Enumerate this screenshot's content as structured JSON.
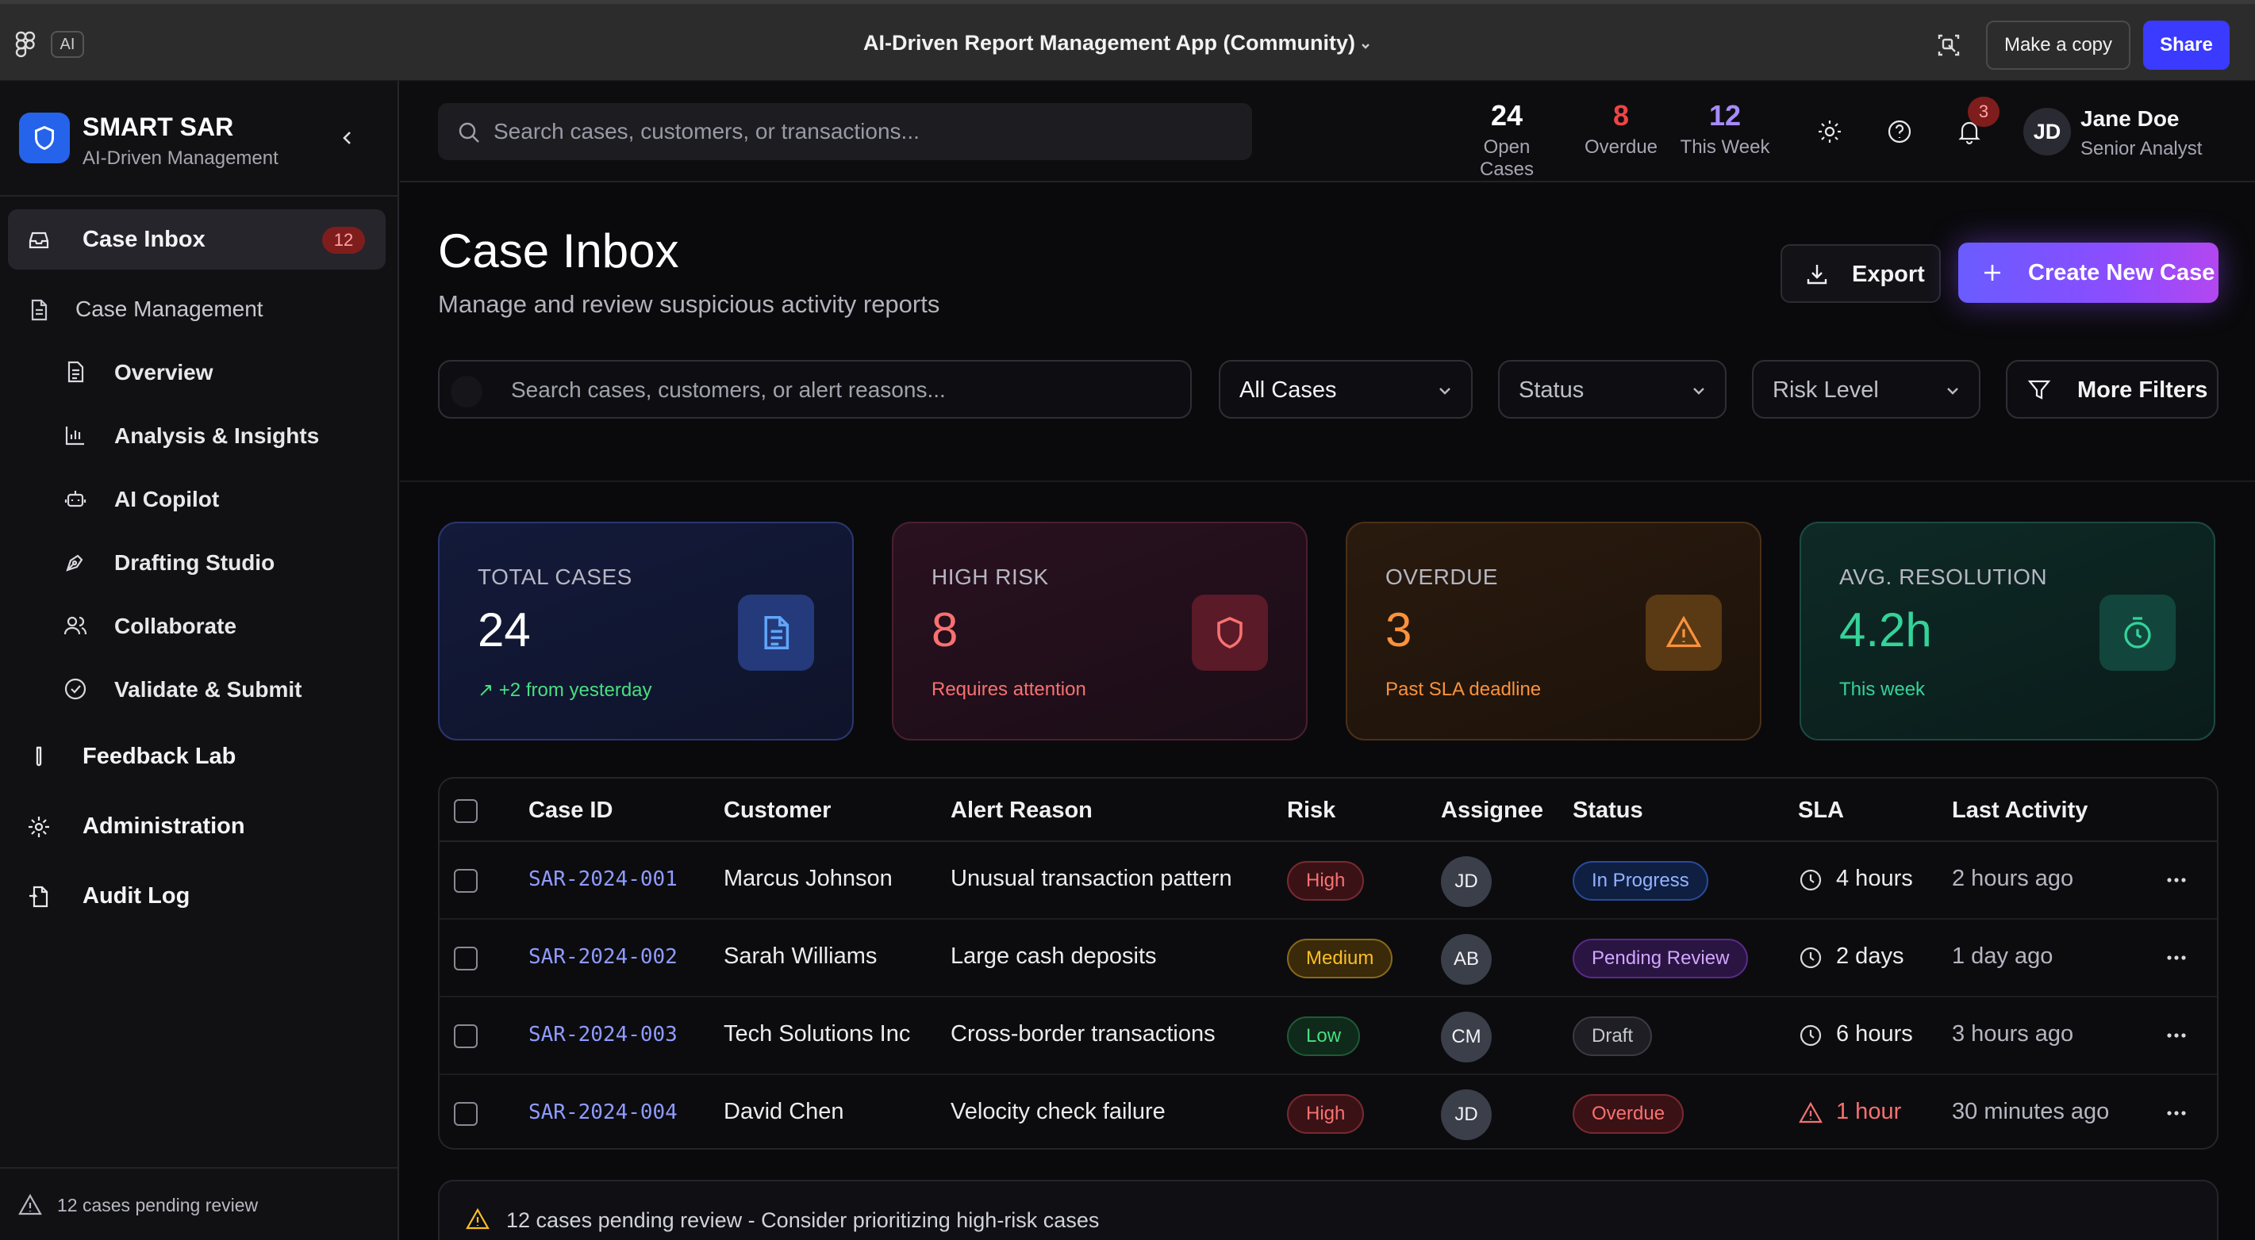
{
  "figma": {
    "ai_chip": "AI",
    "file_title": "AI-Driven Report Management App (Community)",
    "make_copy": "Make a copy",
    "share": "Share"
  },
  "brand": {
    "name": "SMART SAR",
    "subtitle": "AI-Driven Management"
  },
  "sidebar": {
    "case_inbox": {
      "label": "Case Inbox",
      "badge": "12"
    },
    "case_management": {
      "label": "Case Management"
    },
    "sub_items": [
      {
        "label": "Overview",
        "icon": "document-icon"
      },
      {
        "label": "Analysis & Insights",
        "icon": "bar-chart-icon"
      },
      {
        "label": "AI Copilot",
        "icon": "bot-icon"
      },
      {
        "label": "Drafting Studio",
        "icon": "pen-icon"
      },
      {
        "label": "Collaborate",
        "icon": "users-icon"
      },
      {
        "label": "Validate & Submit",
        "icon": "check-circle-icon"
      }
    ],
    "feedback_lab": {
      "label": "Feedback Lab"
    },
    "administration": {
      "label": "Administration"
    },
    "audit_log": {
      "label": "Audit Log"
    },
    "footer": "12 cases pending review"
  },
  "header": {
    "search_placeholder": "Search cases, customers, or transactions...",
    "stats": [
      {
        "value": "24",
        "label": "Open Cases",
        "color": "#ffffff"
      },
      {
        "value": "8",
        "label": "Overdue",
        "color": "#ef4444"
      },
      {
        "value": "12",
        "label": "This Week",
        "color": "#a78bfa"
      }
    ],
    "notifications": "3",
    "user": {
      "initials": "JD",
      "name": "Jane Doe",
      "role": "Senior Analyst"
    }
  },
  "page": {
    "title": "Case Inbox",
    "subtitle": "Manage and review suspicious activity reports",
    "export": "Export",
    "create": "Create New Case"
  },
  "filters": {
    "search_placeholder": "Search cases, customers, or alert reasons...",
    "cases": "All Cases",
    "status": "Status",
    "risk": "Risk Level",
    "more": "More Filters"
  },
  "kpis": [
    {
      "label": "TOTAL CASES",
      "value": "24",
      "note": "+2 from yesterday",
      "accent": "#60a5fa",
      "note_color": "#4ade80",
      "icon": "document-icon"
    },
    {
      "label": "HIGH RISK",
      "value": "8",
      "note": "Requires attention",
      "accent": "#f87171",
      "note_color": "#f87171",
      "icon": "shield-icon"
    },
    {
      "label": "OVERDUE",
      "value": "3",
      "note": "Past SLA deadline",
      "accent": "#fb923c",
      "note_color": "#fb923c",
      "icon": "warning-icon"
    },
    {
      "label": "AVG. RESOLUTION",
      "value": "4.2h",
      "note": "This week",
      "accent": "#34d399",
      "note_color": "#34d399",
      "icon": "timer-icon"
    }
  ],
  "table": {
    "headers": [
      "Case ID",
      "Customer",
      "Alert Reason",
      "Risk",
      "Assignee",
      "Status",
      "SLA",
      "Last Activity"
    ],
    "rows": [
      {
        "id": "SAR-2024-001",
        "customer": "Marcus Johnson",
        "reason": "Unusual transaction pattern",
        "risk": "High",
        "assignee": "JD",
        "status": "In Progress",
        "sla": "4 hours",
        "last": "2 hours ago"
      },
      {
        "id": "SAR-2024-002",
        "customer": "Sarah Williams",
        "reason": "Large cash deposits",
        "risk": "Medium",
        "assignee": "AB",
        "status": "Pending Review",
        "sla": "2 days",
        "last": "1 day ago"
      },
      {
        "id": "SAR-2024-003",
        "customer": "Tech Solutions Inc",
        "reason": "Cross-border transactions",
        "risk": "Low",
        "assignee": "CM",
        "status": "Draft",
        "sla": "6 hours",
        "last": "3 hours ago"
      },
      {
        "id": "SAR-2024-004",
        "customer": "David Chen",
        "reason": "Velocity check failure",
        "risk": "High",
        "assignee": "JD",
        "status": "Overdue",
        "sla": "1 hour",
        "last": "30 minutes ago"
      }
    ]
  },
  "alert": "12 cases pending review - Consider prioritizing high-risk cases"
}
